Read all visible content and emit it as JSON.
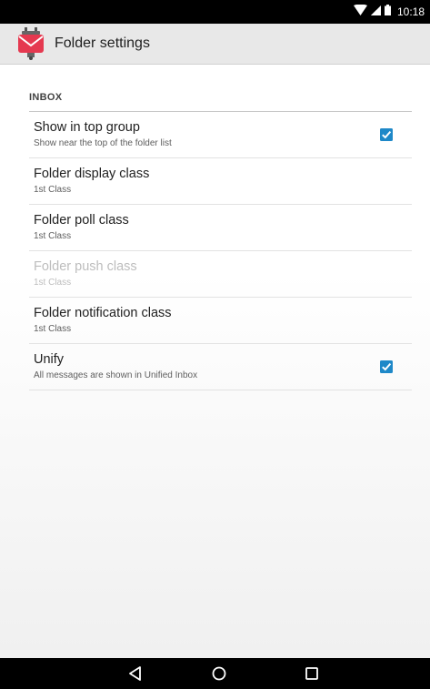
{
  "status_bar": {
    "time": "10:18",
    "icons": [
      "wifi-icon",
      "signal-icon",
      "battery-icon"
    ]
  },
  "action_bar": {
    "title": "Folder settings",
    "app_icon": "k9-mail-icon"
  },
  "category": "INBOX",
  "preferences": [
    {
      "title": "Show in top group",
      "summary": "Show near the top of the folder list",
      "checked": true,
      "enabled": true
    },
    {
      "title": "Folder display class",
      "summary": "1st Class",
      "enabled": true
    },
    {
      "title": "Folder poll class",
      "summary": "1st Class",
      "enabled": true
    },
    {
      "title": "Folder push class",
      "summary": "1st Class",
      "enabled": false
    },
    {
      "title": "Folder notification class",
      "summary": "1st Class",
      "enabled": true
    },
    {
      "title": "Unify",
      "summary": "All messages are shown in Unified Inbox",
      "checked": true,
      "enabled": true
    }
  ],
  "nav_bar": {
    "buttons": [
      "back-icon",
      "home-icon",
      "recents-icon"
    ]
  },
  "colors": {
    "accent": "#1e88c8",
    "app_icon_red": "#e53950"
  }
}
